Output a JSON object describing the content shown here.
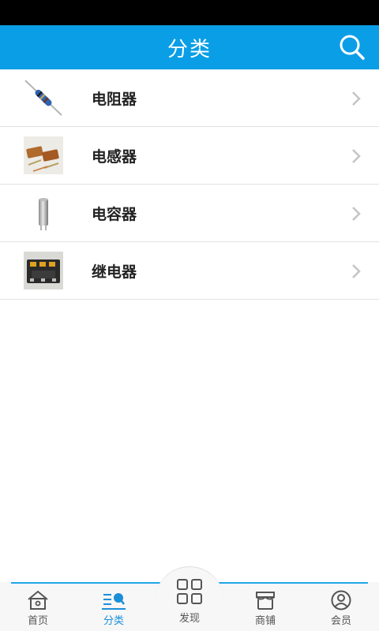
{
  "header": {
    "title": "分类",
    "search_icon": "search-icon"
  },
  "categories": [
    {
      "label": "电阻器",
      "thumb": "resistor-image"
    },
    {
      "label": "电感器",
      "thumb": "inductor-image"
    },
    {
      "label": "电容器",
      "thumb": "capacitor-image"
    },
    {
      "label": "继电器",
      "thumb": "relay-image"
    }
  ],
  "tabbar": {
    "home": "首页",
    "category": "分类",
    "discover": "发现",
    "shop": "商铺",
    "member": "会员"
  },
  "colors": {
    "primary": "#0a9ee6",
    "active_tab": "#1a8fd8"
  }
}
